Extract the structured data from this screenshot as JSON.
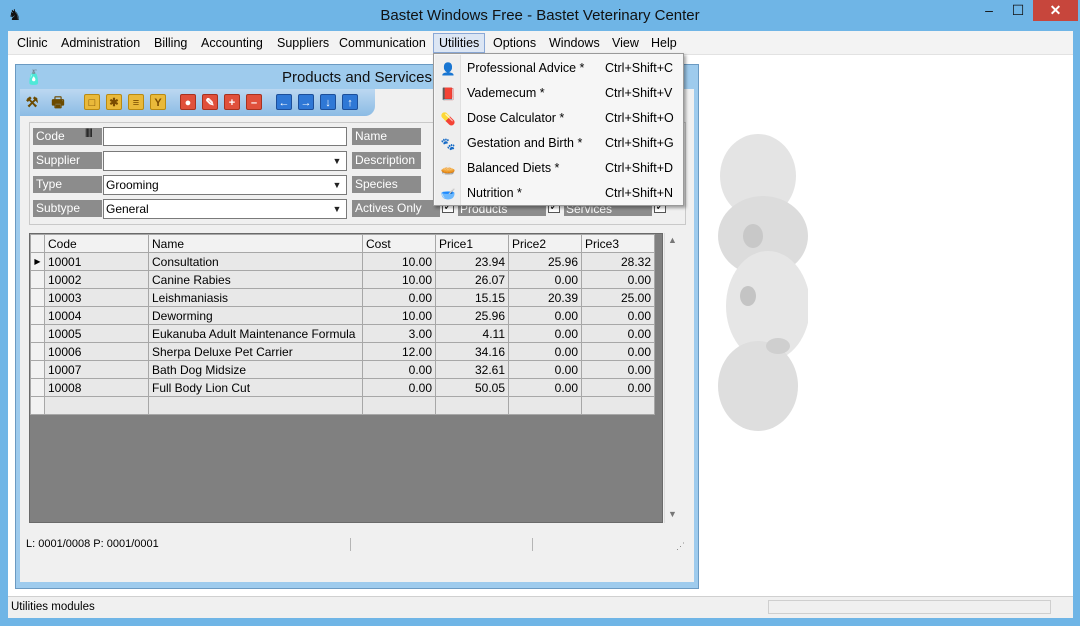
{
  "window": {
    "title": "Bastet Windows Free - Bastet Veterinary Center",
    "min": "–",
    "max": "☐",
    "close": "✕"
  },
  "menu": [
    "Clinic",
    "Administration",
    "Billing",
    "Accounting",
    "Suppliers",
    "Communication",
    "Utilities",
    "Options",
    "Windows",
    "View",
    "Help"
  ],
  "child": {
    "title": "Products and Services"
  },
  "filters": {
    "code_label": "Code",
    "code_value": "",
    "name_label": "Name",
    "supplier_label": "Supplier",
    "supplier_value": "",
    "description_label": "Description",
    "type_label": "Type",
    "type_value": "Grooming",
    "species_label": "Species",
    "subtype_label": "Subtype",
    "subtype_value": "General",
    "actives_only_label": "Actives Only",
    "products_label": "Products",
    "services_label": "Services"
  },
  "grid": {
    "columns": [
      "Code",
      "Name",
      "Cost",
      "Price1",
      "Price2",
      "Price3"
    ],
    "rows": [
      [
        "10001",
        "Consultation",
        "10.00",
        "23.94",
        "25.96",
        "28.32"
      ],
      [
        "10002",
        "Canine Rabies",
        "10.00",
        "26.07",
        "0.00",
        "0.00"
      ],
      [
        "10003",
        "Leishmaniasis",
        "0.00",
        "15.15",
        "20.39",
        "25.00"
      ],
      [
        "10004",
        "Deworming",
        "10.00",
        "25.96",
        "0.00",
        "0.00"
      ],
      [
        "10005",
        "Eukanuba Adult Maintenance Formula",
        "3.00",
        "4.11",
        "0.00",
        "0.00"
      ],
      [
        "10006",
        "Sherpa Deluxe Pet Carrier",
        "12.00",
        "34.16",
        "0.00",
        "0.00"
      ],
      [
        "10007",
        "Bath Dog Midsize",
        "0.00",
        "32.61",
        "0.00",
        "0.00"
      ],
      [
        "10008",
        "Full Body Lion Cut",
        "0.00",
        "50.05",
        "0.00",
        "0.00"
      ]
    ]
  },
  "child_status": "L: 0001/0008  P: 0001/0001",
  "status": "Utilities modules",
  "utilities_menu": [
    {
      "label": "Professional Advice *",
      "shortcut": "Ctrl+Shift+C",
      "icon": "advisor-icon"
    },
    {
      "label": "Vademecum *",
      "shortcut": "Ctrl+Shift+V",
      "icon": "book-icon"
    },
    {
      "label": "Dose Calculator *",
      "shortcut": "Ctrl+Shift+O",
      "icon": "pill-icon"
    },
    {
      "label": "Gestation and Birth *",
      "shortcut": "Ctrl+Shift+G",
      "icon": "litter-icon"
    },
    {
      "label": "Balanced Diets *",
      "shortcut": "Ctrl+Shift+D",
      "icon": "food-icon"
    },
    {
      "label": "Nutrition *",
      "shortcut": "Ctrl+Shift+N",
      "icon": "bowl-icon"
    }
  ],
  "colors": {
    "titlebar": "#6fb5e6",
    "close_button": "#c7463c",
    "grid_background": "#808080",
    "label_background": "#8c8c8c"
  }
}
